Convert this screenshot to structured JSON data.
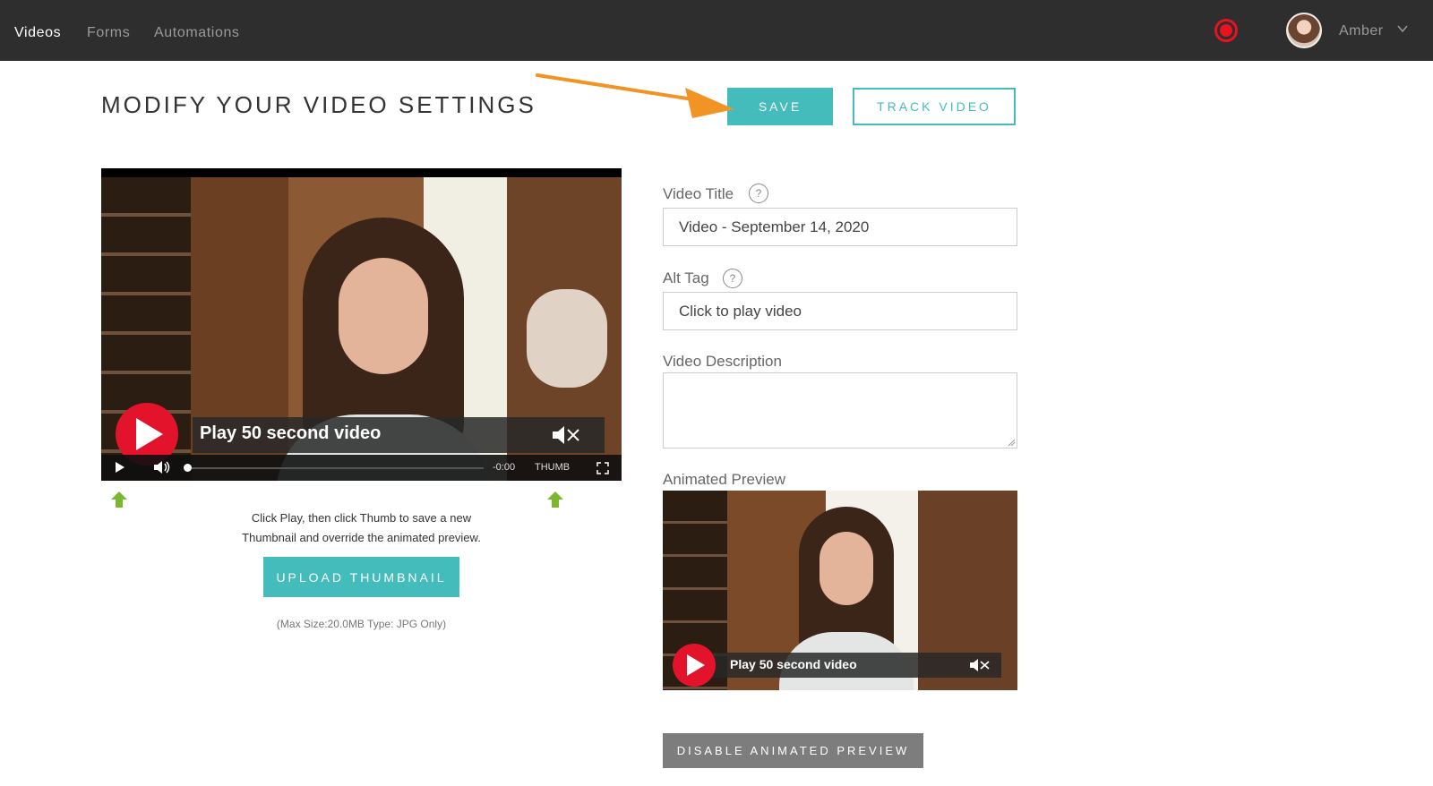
{
  "nav": {
    "items": [
      {
        "label": "Videos",
        "active": true
      },
      {
        "label": "Forms",
        "active": false
      },
      {
        "label": "Automations",
        "active": false
      }
    ],
    "user_name": "Amber"
  },
  "header": {
    "title": "MODIFY YOUR VIDEO SETTINGS",
    "save_label": "SAVE",
    "track_label": "TRACK VIDEO"
  },
  "player": {
    "overlay_label": "Play 50 second video",
    "time": "-0:00",
    "thumb_label": "THUMB"
  },
  "thumbnail": {
    "help_line1": "Click Play, then click Thumb to save a new",
    "help_line2": "Thumbnail and override the animated preview.",
    "upload_label": "UPLOAD THUMBNAIL",
    "size_note": "(Max Size:20.0MB  Type: JPG Only)"
  },
  "form": {
    "title_label": "Video Title",
    "title_value": "Video - September 14, 2020",
    "alt_label": "Alt Tag",
    "alt_value": "Click to play video",
    "description_label": "Video Description",
    "description_value": "",
    "help_glyph": "?",
    "preview_label": "Animated Preview",
    "preview_overlay_label": "Play 50 second video",
    "disable_label": "DISABLE ANIMATED PREVIEW"
  },
  "colors": {
    "accent": "#44bcbc",
    "topbar": "#2e2e2e",
    "record": "#e8131f",
    "play": "#e3132b",
    "annotation_arrow": "#f29423",
    "hint_arrow": "#7cb82f"
  },
  "icons": [
    "record-icon",
    "avatar",
    "chevron-down-icon",
    "play-icon",
    "volume-icon",
    "mute-icon",
    "fullscreen-icon",
    "help-icon",
    "green-up-arrow-icon",
    "orange-arrow-annotation"
  ]
}
